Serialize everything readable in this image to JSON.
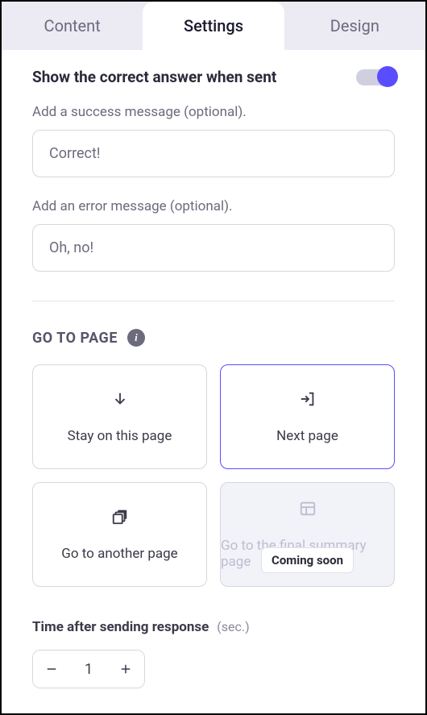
{
  "tabs": {
    "content": "Content",
    "settings": "Settings",
    "design": "Design"
  },
  "showAnswer": {
    "label": "Show the correct answer when sent",
    "on": true
  },
  "successMsg": {
    "label": "Add a success message (optional).",
    "value": "Correct!"
  },
  "errorMsg": {
    "label": "Add an error message (optional).",
    "value": "Oh, no!"
  },
  "goToPage": {
    "title": "GO TO PAGE",
    "options": {
      "stay": "Stay on this page",
      "next": "Next page",
      "another": "Go to another page",
      "final": "Go to the final summary page"
    },
    "badge": "Coming soon"
  },
  "time": {
    "label": "Time after sending response",
    "unit": "(sec.)",
    "value": "1"
  }
}
